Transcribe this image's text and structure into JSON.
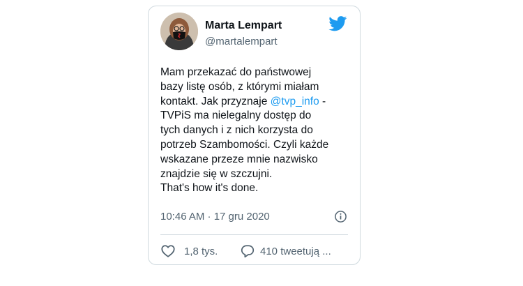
{
  "tweet": {
    "author_name": "Marta Lempart",
    "author_handle": "@martalempart",
    "text_lines": [
      "Mam przekazać do państwowej",
      "bazy listę osób, z którymi miałam",
      "kontakt. Jak przyznaje ",
      "TVPiS ma nielegalny dostęp do",
      "tych danych i z nich korzysta do",
      "potrzeb  Szambomości. Czyli każde",
      "wskazane przeze mnie nazwisko",
      "znajdzie się w szczujni.",
      "That's how it's done."
    ],
    "mention": "@tvp_info",
    "mention_suffix": " -",
    "timestamp": "10:46 AM · 17 gru 2020",
    "likes": "1,8 tys.",
    "replies": "410 tweetują ..."
  },
  "colors": {
    "link": "#1d9bf0",
    "secondary_text": "#536471",
    "border": "#cfd9de",
    "twitter_blue": "#1d9bf0"
  },
  "icons": {
    "brand": "twitter-bird-icon",
    "info": "info-icon",
    "like": "heart-icon",
    "reply": "speech-bubble-icon"
  }
}
